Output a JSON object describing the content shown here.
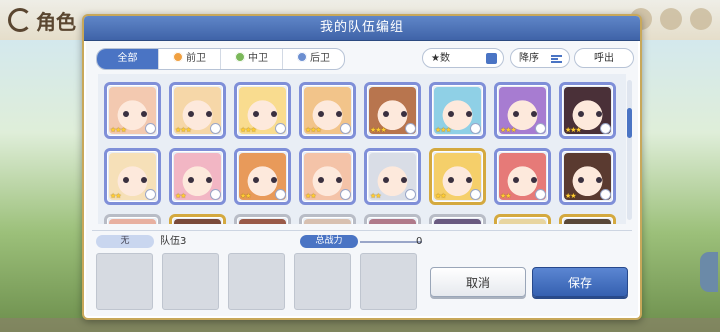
{
  "background": {
    "logo_text": "角色"
  },
  "modal": {
    "title": "我的队伍编组"
  },
  "filters": {
    "tabs": [
      {
        "label": "全部",
        "active": true
      },
      {
        "label": "前卫",
        "active": false
      },
      {
        "label": "中卫",
        "active": false
      },
      {
        "label": "后卫",
        "active": false
      }
    ],
    "star_sort_label": "★数",
    "order_label": "降序",
    "call_label": "呼出"
  },
  "roster": {
    "rows": [
      [
        {
          "frame": "purple",
          "stars": "★★★",
          "color": "#f3c9b0"
        },
        {
          "frame": "purple",
          "stars": "★★★",
          "color": "#f6d7a8"
        },
        {
          "frame": "purple",
          "stars": "★★★",
          "color": "#f9dc8f"
        },
        {
          "frame": "purple",
          "stars": "★★★",
          "color": "#f2c48a"
        },
        {
          "frame": "purple",
          "stars": "★★★",
          "color": "#b8754e"
        },
        {
          "frame": "purple",
          "stars": "★★★",
          "color": "#8fd0e6"
        },
        {
          "frame": "purple",
          "stars": "★★★",
          "color": "#a77cd1"
        },
        {
          "frame": "purple",
          "stars": "★★★",
          "color": "#4a3038"
        }
      ],
      [
        {
          "frame": "purple",
          "stars": "★★",
          "color": "#f6e0b8"
        },
        {
          "frame": "purple",
          "stars": "★★",
          "color": "#f2b6c4"
        },
        {
          "frame": "purple",
          "stars": "★★",
          "color": "#e89a5a"
        },
        {
          "frame": "purple",
          "stars": "★★",
          "color": "#f4c3a8"
        },
        {
          "frame": "purple",
          "stars": "★★",
          "color": "#d9dde6"
        },
        {
          "frame": "gold",
          "stars": "★★",
          "color": "#f5cf6a"
        },
        {
          "frame": "purple",
          "stars": "★★",
          "color": "#e67a78"
        },
        {
          "frame": "purple",
          "stars": "★★",
          "color": "#5a3a30"
        }
      ],
      [
        {
          "frame": "silver",
          "stars": "",
          "color": "#e8b0a0"
        },
        {
          "frame": "gold",
          "stars": "",
          "color": "#7a4a3a"
        },
        {
          "frame": "silver",
          "stars": "",
          "color": "#9a5a48"
        },
        {
          "frame": "silver",
          "stars": "",
          "color": "#d8c0b0"
        },
        {
          "frame": "silver",
          "stars": "",
          "color": "#b07a8a"
        },
        {
          "frame": "silver",
          "stars": "",
          "color": "#6a5a80"
        },
        {
          "frame": "gold",
          "stars": "",
          "color": "#e8d5a0"
        },
        {
          "frame": "gold",
          "stars": "",
          "color": "#5a4838"
        }
      ]
    ]
  },
  "team": {
    "slot_label": "无",
    "name": "队伍3",
    "power_label": "总战力",
    "power_value": "0"
  },
  "actions": {
    "cancel_label": "取消",
    "save_label": "保存"
  }
}
